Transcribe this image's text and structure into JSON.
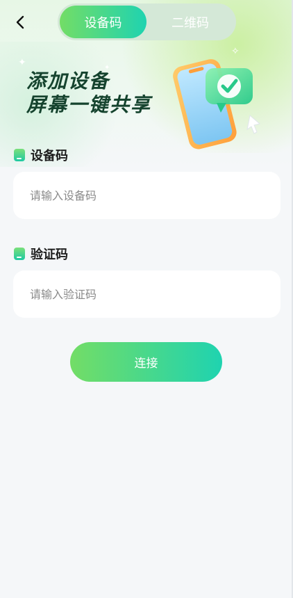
{
  "header": {
    "back_icon": "chevron-left-icon",
    "tabs": [
      {
        "label": "设备码",
        "active": true
      },
      {
        "label": "二维码",
        "active": false
      }
    ]
  },
  "banner": {
    "line1": "添加设备",
    "line2": "屏幕一键共享",
    "illustration_icon": "phone-checkmark-icon"
  },
  "form": {
    "device_code": {
      "label": "设备码",
      "placeholder": "请输入设备码",
      "value": ""
    },
    "verify_code": {
      "label": "验证码",
      "placeholder": "请输入验证码",
      "value": ""
    }
  },
  "actions": {
    "connect_label": "连接"
  },
  "colors": {
    "accent_start": "#73dd66",
    "accent_end": "#1fd3b0",
    "title_text": "#15432e",
    "background": "#f5f7f9"
  }
}
